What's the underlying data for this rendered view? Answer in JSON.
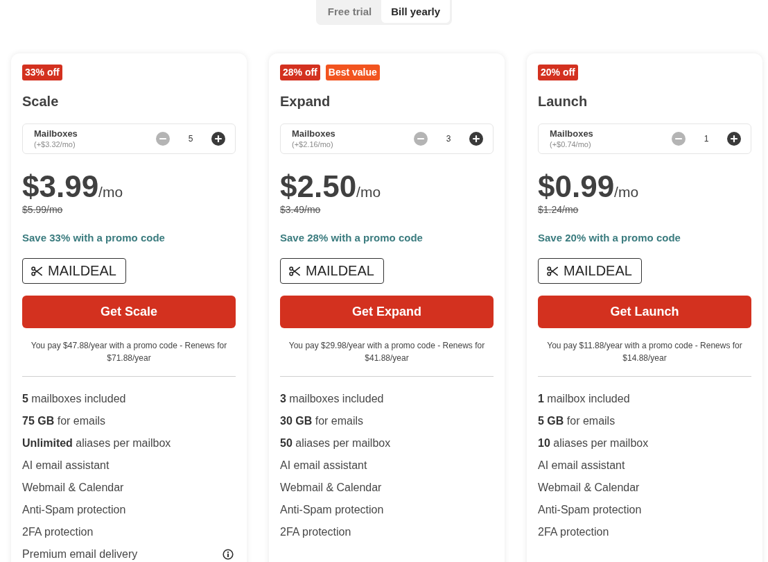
{
  "billing_toggle": {
    "options": [
      {
        "label": "Free trial",
        "selected": false
      },
      {
        "label": "Bill yearly",
        "selected": true
      }
    ]
  },
  "plans": [
    {
      "badges": [
        {
          "text": "33% off",
          "color": "#d3311f"
        }
      ],
      "name": "Scale",
      "stepper": {
        "label": "Mailboxes",
        "note": "(+$3.32/mo)",
        "value": "5",
        "decrease_disabled": true
      },
      "price": "$3.99",
      "period": "/mo",
      "original_price": "$5.99/mo",
      "savings": "Save 33% with a promo code",
      "promo_code": "MAILDEAL",
      "cta": "Get Scale",
      "billing_note": "You pay $47.88/year with a promo code - Renews for $71.88/year",
      "features": [
        {
          "text": "**5** mailboxes included",
          "info": false
        },
        {
          "text": "**75 GB** for emails",
          "info": false
        },
        {
          "text": "**Unlimited** aliases per mailbox",
          "info": false
        },
        {
          "text": "AI email assistant",
          "info": false
        },
        {
          "text": "Webmail & Calendar",
          "info": false
        },
        {
          "text": "Anti-Spam protection",
          "info": false
        },
        {
          "text": "2FA protection",
          "info": false
        },
        {
          "text": "Premium email delivery",
          "info": true
        }
      ]
    },
    {
      "badges": [
        {
          "text": "28% off",
          "color": "#d3311f"
        },
        {
          "text": "Best value",
          "color": "#f2541f"
        }
      ],
      "name": "Expand",
      "stepper": {
        "label": "Mailboxes",
        "note": "(+$2.16/mo)",
        "value": "3",
        "decrease_disabled": true
      },
      "price": "$2.50",
      "period": "/mo",
      "original_price": "$3.49/mo",
      "savings": "Save 28% with a promo code",
      "promo_code": "MAILDEAL",
      "cta": "Get Expand",
      "billing_note": "You pay $29.98/year with a promo code - Renews for $41.88/year",
      "features": [
        {
          "text": "**3** mailboxes included",
          "info": false
        },
        {
          "text": "**30 GB** for emails",
          "info": false
        },
        {
          "text": "**50** aliases per mailbox",
          "info": false
        },
        {
          "text": "AI email assistant",
          "info": false
        },
        {
          "text": "Webmail & Calendar",
          "info": false
        },
        {
          "text": "Anti-Spam protection",
          "info": false
        },
        {
          "text": "2FA protection",
          "info": false
        }
      ]
    },
    {
      "badges": [
        {
          "text": "20% off",
          "color": "#d3311f"
        }
      ],
      "name": "Launch",
      "stepper": {
        "label": "Mailboxes",
        "note": "(+$0.74/mo)",
        "value": "1",
        "decrease_disabled": true
      },
      "price": "$0.99",
      "period": "/mo",
      "original_price": "$1.24/mo",
      "savings": "Save 20% with a promo code",
      "promo_code": "MAILDEAL",
      "cta": "Get Launch",
      "billing_note": "You pay $11.88/year with a promo code - Renews for $14.88/year",
      "features": [
        {
          "text": "**1** mailbox included",
          "info": false
        },
        {
          "text": "**5 GB** for emails",
          "info": false
        },
        {
          "text": "**10** aliases per mailbox",
          "info": false
        },
        {
          "text": "AI email assistant",
          "info": false
        },
        {
          "text": "Webmail & Calendar",
          "info": false
        },
        {
          "text": "Anti-Spam protection",
          "info": false
        },
        {
          "text": "2FA protection",
          "info": false
        }
      ]
    }
  ]
}
